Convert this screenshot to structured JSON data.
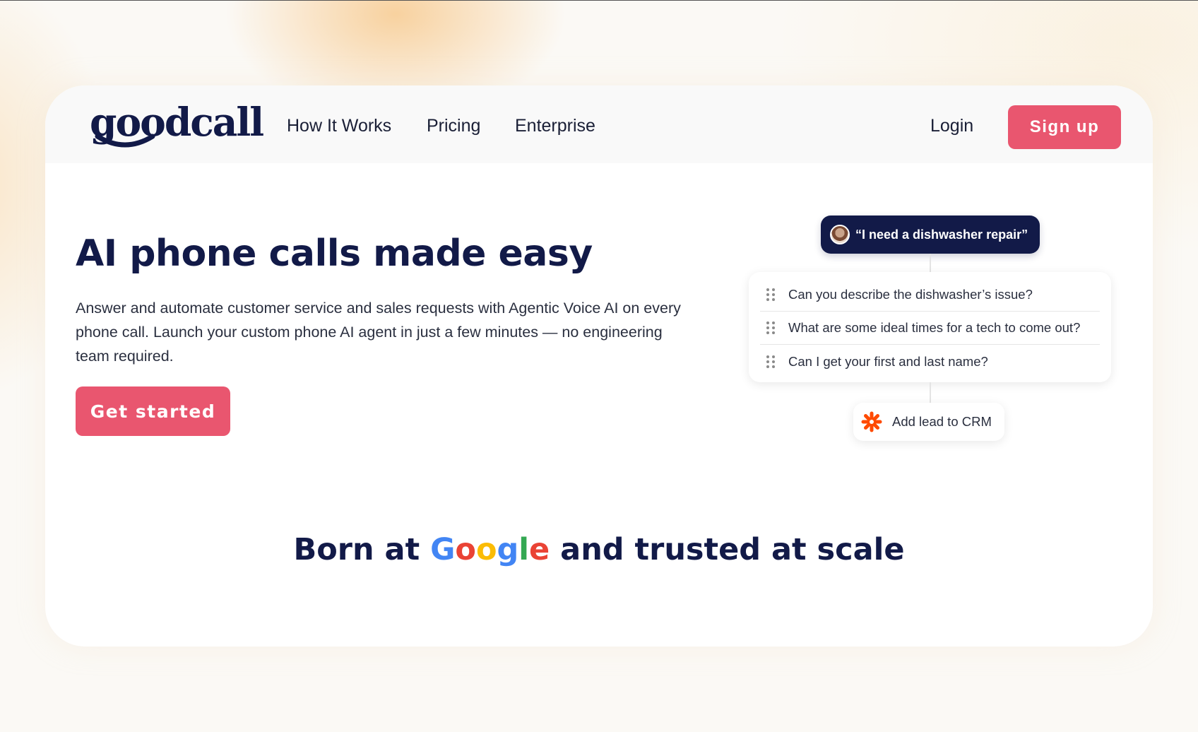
{
  "brand": {
    "logo_text": "goodcall",
    "accent_color": "#e9566f",
    "navy_color": "#121a48"
  },
  "nav": {
    "links": [
      "How It Works",
      "Pricing",
      "Enterprise"
    ],
    "login_label": "Login",
    "signup_label": "Sign up"
  },
  "hero": {
    "title": "AI phone calls made easy",
    "description": "Answer and automate customer service and sales requests with Agentic Voice AI on every phone call. Launch your custom phone AI agent in just a few minutes — no engineering team required.",
    "cta_label": "Get started"
  },
  "flow": {
    "caller_quote": "“I need a dishwasher repair”",
    "questions": [
      "Can you describe the dishwasher’s issue?",
      "What are some ideal times for a tech to come out?",
      "Can I get your first and last name?"
    ],
    "action_label": "Add lead to CRM",
    "action_icon": "asterisk-icon"
  },
  "trust": {
    "prefix": "Born at ",
    "google_letters": [
      "G",
      "o",
      "o",
      "g",
      "l",
      "e"
    ],
    "google_colors": [
      "#4285f4",
      "#ea4335",
      "#fbbc05",
      "#4285f4",
      "#34a853",
      "#ea4335"
    ],
    "suffix": " and trusted at scale"
  }
}
